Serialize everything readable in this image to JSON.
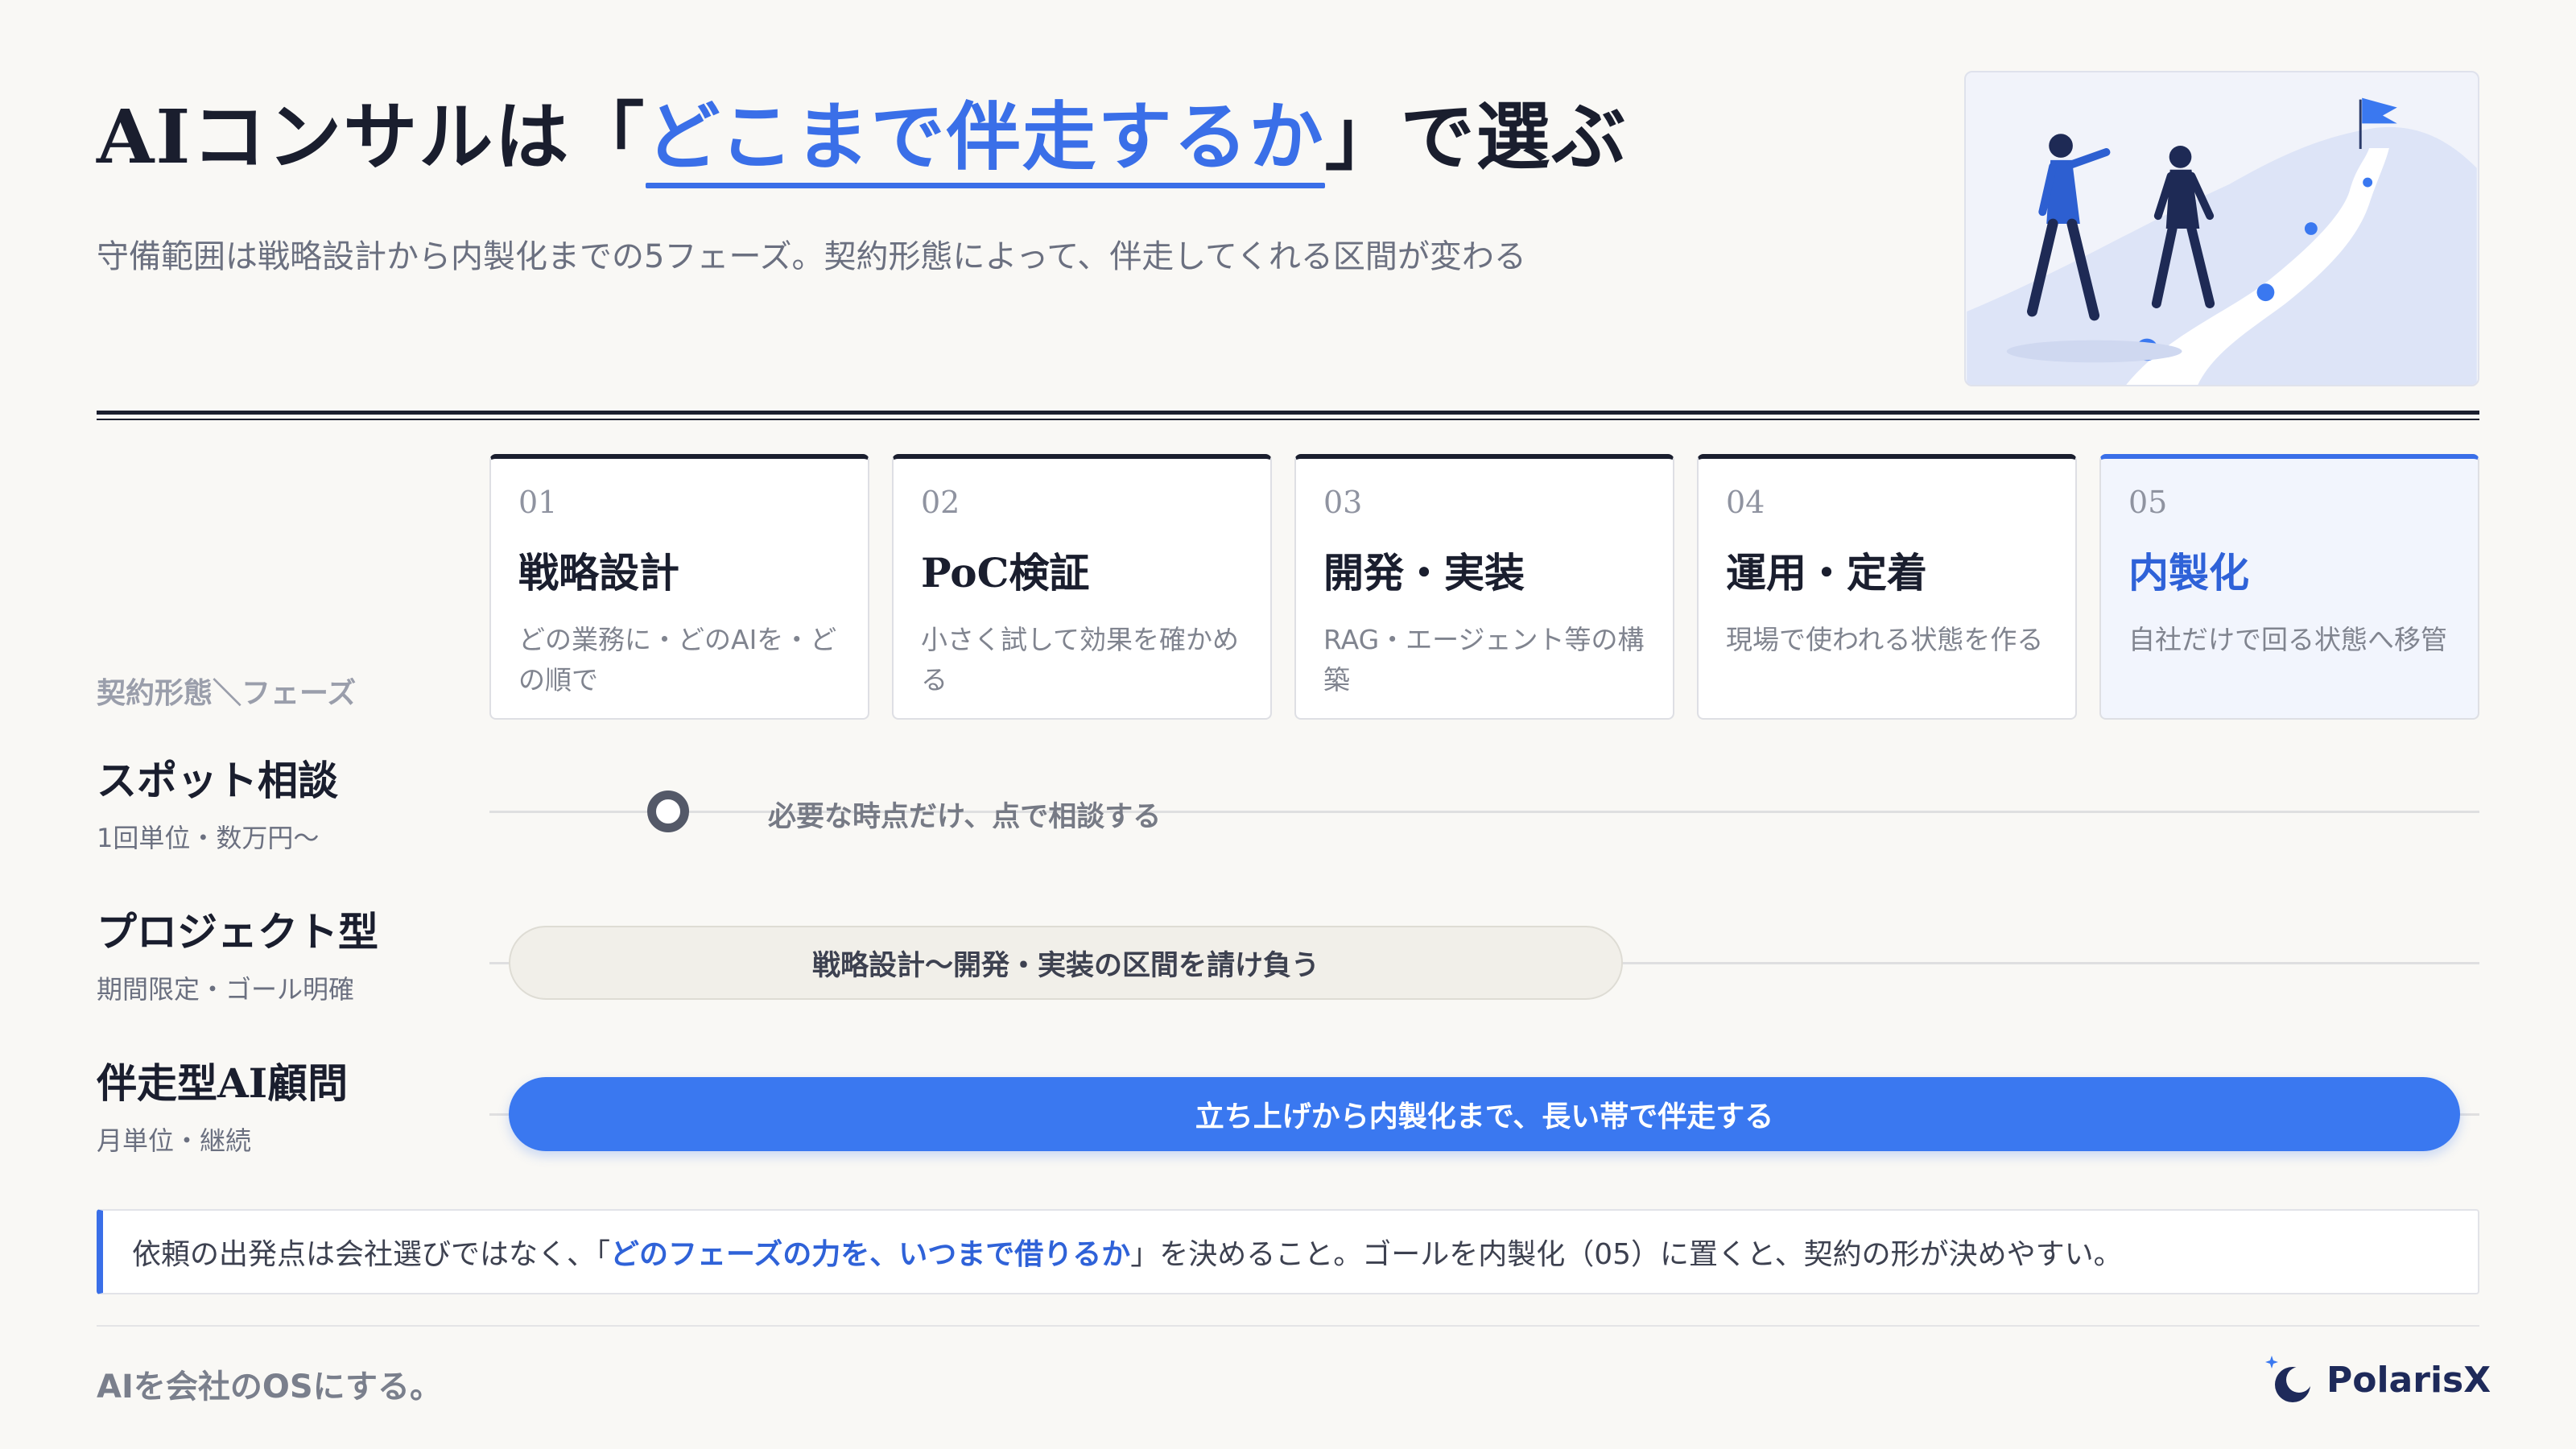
{
  "header": {
    "title_before": "AIコンサルは「",
    "title_highlight": "どこまで伴走するか",
    "title_after": "」で選ぶ",
    "subtitle": "守備範囲は戦略設計から内製化までの5フェーズ。契約形態によって、伴走してくれる区間が変わる"
  },
  "axis_label": "契約形態＼フェーズ",
  "phases": [
    {
      "num": "01",
      "name": "戦略設計",
      "desc": "どの業務に・どのAIを・どの順で"
    },
    {
      "num": "02",
      "name": "PoC検証",
      "desc": "小さく試して効果を確かめる"
    },
    {
      "num": "03",
      "name": "開発・実装",
      "desc": "RAG・エージェント等の構築"
    },
    {
      "num": "04",
      "name": "運用・定着",
      "desc": "現場で使われる状態を作る"
    },
    {
      "num": "05",
      "name": "内製化",
      "desc": "自社だけで回る状態へ移管"
    }
  ],
  "rows": [
    {
      "title": "スポット相談",
      "sub": "1回単位・数万円〜",
      "coverage_text": "必要な時点だけ、点で相談する"
    },
    {
      "title": "プロジェクト型",
      "sub": "期間限定・ゴール明確",
      "coverage_text": "戦略設計〜開発・実装の区間を請け負う"
    },
    {
      "title": "伴走型AI顧問",
      "sub": "月単位・継続",
      "coverage_text": "立ち上げから内製化まで、長い帯で伴走する"
    }
  ],
  "note": {
    "before": "依頼の出発点は会社選びではなく、「",
    "strong": "どのフェーズの力を、いつまで借りるか",
    "after": "」を決めること。ゴールを内製化（05）に置くと、契約の形が決めやすい。"
  },
  "footer": {
    "tagline": "AIを会社のOSにする。",
    "brand": "PolarisX"
  },
  "colors": {
    "accent": "#3a6fe8",
    "dark": "#1a1e2e",
    "background": "#f9f8f5"
  },
  "icons": {
    "illustration": "two-people-walking-to-flag",
    "logo": "polarisx-logo-icon"
  }
}
